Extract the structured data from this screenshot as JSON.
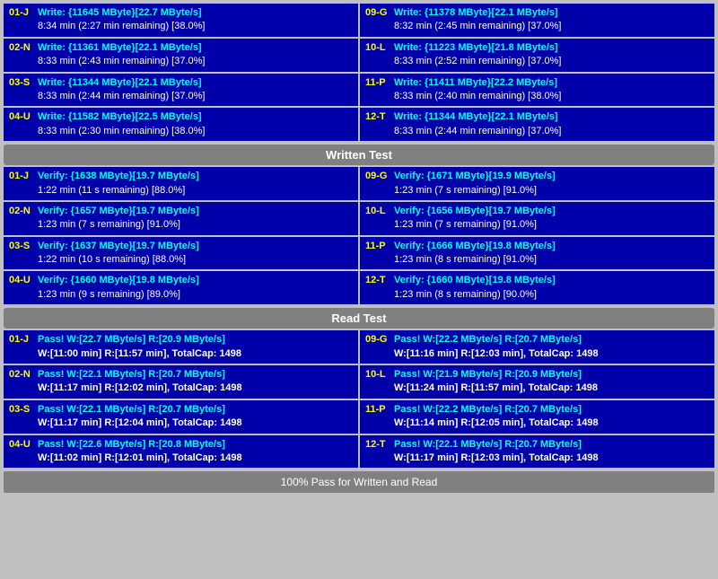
{
  "sections": {
    "write_test": {
      "label": "Written Test",
      "rows": [
        {
          "left": {
            "id": "01-J",
            "line1": "Write: {11645 MByte}[22.7 MByte/s]",
            "line2": "8:34 min (2:27 min remaining)  [38.0%]"
          },
          "right": {
            "id": "09-G",
            "line1": "Write: {11378 MByte}[22.1 MByte/s]",
            "line2": "8:32 min (2:45 min remaining)  [37.0%]"
          }
        },
        {
          "left": {
            "id": "02-N",
            "line1": "Write: {11361 MByte}[22.1 MByte/s]",
            "line2": "8:33 min (2:43 min remaining)  [37.0%]"
          },
          "right": {
            "id": "10-L",
            "line1": "Write: {11223 MByte}[21.8 MByte/s]",
            "line2": "8:33 min (2:52 min remaining)  [37.0%]"
          }
        },
        {
          "left": {
            "id": "03-S",
            "line1": "Write: {11344 MByte}[22.1 MByte/s]",
            "line2": "8:33 min (2:44 min remaining)  [37.0%]"
          },
          "right": {
            "id": "11-P",
            "line1": "Write: {11411 MByte}[22.2 MByte/s]",
            "line2": "8:33 min (2:40 min remaining)  [38.0%]"
          }
        },
        {
          "left": {
            "id": "04-U",
            "line1": "Write: {11582 MByte}[22.5 MByte/s]",
            "line2": "8:33 min (2:30 min remaining)  [38.0%]"
          },
          "right": {
            "id": "12-T",
            "line1": "Write: {11344 MByte}[22.1 MByte/s]",
            "line2": "8:33 min (2:44 min remaining)  [37.0%]"
          }
        }
      ]
    },
    "verify_test": {
      "label": "Written Test",
      "rows": [
        {
          "left": {
            "id": "01-J",
            "line1": "Verify: {1638 MByte}[19.7 MByte/s]",
            "line2": "1:22 min (11 s remaining)   [88.0%]"
          },
          "right": {
            "id": "09-G",
            "line1": "Verify: {1671 MByte}[19.9 MByte/s]",
            "line2": "1:23 min (7 s remaining)   [91.0%]"
          }
        },
        {
          "left": {
            "id": "02-N",
            "line1": "Verify: {1657 MByte}[19.7 MByte/s]",
            "line2": "1:23 min (7 s remaining)   [91.0%]"
          },
          "right": {
            "id": "10-L",
            "line1": "Verify: {1656 MByte}[19.7 MByte/s]",
            "line2": "1:23 min (7 s remaining)   [91.0%]"
          }
        },
        {
          "left": {
            "id": "03-S",
            "line1": "Verify: {1637 MByte}[19.7 MByte/s]",
            "line2": "1:22 min (10 s remaining)   [88.0%]"
          },
          "right": {
            "id": "11-P",
            "line1": "Verify: {1666 MByte}[19.8 MByte/s]",
            "line2": "1:23 min (8 s remaining)   [91.0%]"
          }
        },
        {
          "left": {
            "id": "04-U",
            "line1": "Verify: {1660 MByte}[19.8 MByte/s]",
            "line2": "1:23 min (9 s remaining)   [89.0%]"
          },
          "right": {
            "id": "12-T",
            "line1": "Verify: {1660 MByte}[19.8 MByte/s]",
            "line2": "1:23 min (8 s remaining)   [90.0%]"
          }
        }
      ]
    },
    "read_test": {
      "label": "Read Test",
      "rows": [
        {
          "left": {
            "id": "01-J",
            "line1": "Pass! W:[22.7 MByte/s] R:[20.9 MByte/s]",
            "line2": "W:[11:00 min] R:[11:57 min], TotalCap: 1498"
          },
          "right": {
            "id": "09-G",
            "line1": "Pass! W:[22.2 MByte/s] R:[20.7 MByte/s]",
            "line2": "W:[11:16 min] R:[12:03 min], TotalCap: 1498"
          }
        },
        {
          "left": {
            "id": "02-N",
            "line1": "Pass! W:[22.1 MByte/s] R:[20.7 MByte/s]",
            "line2": "W:[11:17 min] R:[12:02 min], TotalCap: 1498"
          },
          "right": {
            "id": "10-L",
            "line1": "Pass! W:[21.9 MByte/s] R:[20.9 MByte/s]",
            "line2": "W:[11:24 min] R:[11:57 min], TotalCap: 1498"
          }
        },
        {
          "left": {
            "id": "03-S",
            "line1": "Pass! W:[22.1 MByte/s] R:[20.7 MByte/s]",
            "line2": "W:[11:17 min] R:[12:04 min], TotalCap: 1498"
          },
          "right": {
            "id": "11-P",
            "line1": "Pass! W:[22.2 MByte/s] R:[20.7 MByte/s]",
            "line2": "W:[11:14 min] R:[12:05 min], TotalCap: 1498"
          }
        },
        {
          "left": {
            "id": "04-U",
            "line1": "Pass! W:[22.6 MByte/s] R:[20.8 MByte/s]",
            "line2": "W:[11:02 min] R:[12:01 min], TotalCap: 1498"
          },
          "right": {
            "id": "12-T",
            "line1": "Pass! W:[22.1 MByte/s] R:[20.7 MByte/s]",
            "line2": "W:[11:17 min] R:[12:03 min], TotalCap: 1498"
          }
        }
      ]
    }
  },
  "bottom_label": "100% Pass for Written and Read",
  "section_labels": {
    "write": "Written Test",
    "read": "Read Test"
  }
}
